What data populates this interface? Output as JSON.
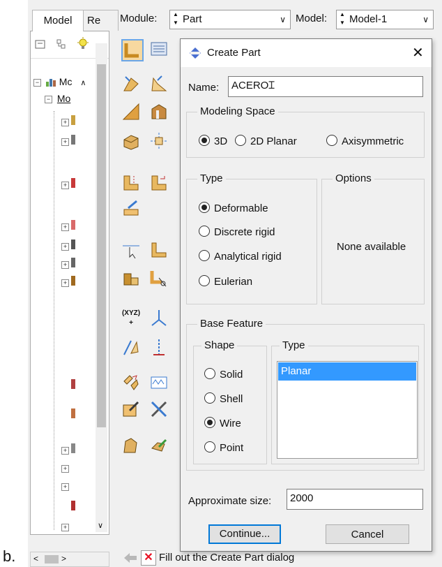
{
  "caption": "b.",
  "tabs": [
    {
      "label": "Model"
    },
    {
      "label": "Re"
    }
  ],
  "tree": {
    "root_label": "Mc",
    "child_label": "Mo"
  },
  "topbar": {
    "module_label": "Module:",
    "module_value": "Part",
    "model_label": "Model:",
    "model_value": "Model-1"
  },
  "dialog": {
    "title": "Create Part",
    "name_label": "Name:",
    "name_value": "ACERO",
    "modeling_space": {
      "title": "Modeling Space",
      "options": [
        "3D",
        "2D Planar",
        "Axisymmetric"
      ],
      "selected": "3D"
    },
    "type": {
      "title": "Type",
      "options": [
        "Deformable",
        "Discrete rigid",
        "Analytical rigid",
        "Eulerian"
      ],
      "selected": "Deformable"
    },
    "options_group": {
      "title": "Options",
      "text": "None available"
    },
    "base_feature": {
      "title": "Base Feature",
      "shape_title": "Shape",
      "shapes": [
        "Solid",
        "Shell",
        "Wire",
        "Point"
      ],
      "selected_shape": "Wire",
      "type_title": "Type",
      "type_items": [
        "Planar"
      ],
      "selected_type": "Planar"
    },
    "approx_label": "Approximate size:",
    "approx_value": "2000",
    "continue_label": "Continue...",
    "cancel_label": "Cancel"
  },
  "status": {
    "message": "Fill out the Create Part dialog"
  },
  "colors": {
    "selection": "#3399ff",
    "title_icon": "#4a6fd0",
    "cancel_x": "#e81123"
  }
}
